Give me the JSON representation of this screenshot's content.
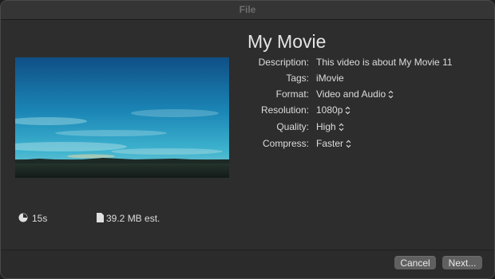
{
  "window": {
    "title": "File"
  },
  "movie": {
    "title": "My Movie"
  },
  "fields": [
    {
      "label": "Description:",
      "value": "This video is about My Movie 11",
      "stepper": false
    },
    {
      "label": "Tags:",
      "value": "iMovie",
      "stepper": false
    },
    {
      "label": "Format:",
      "value": "Video and Audio",
      "stepper": true
    },
    {
      "label": "Resolution:",
      "value": "1080p",
      "stepper": true
    },
    {
      "label": "Quality:",
      "value": "High",
      "stepper": true
    },
    {
      "label": "Compress:",
      "value": "Faster",
      "stepper": true
    }
  ],
  "stats": {
    "duration": "15s",
    "size": "39.2 MB est.",
    "duration_icon": "clock-icon",
    "size_icon": "document-icon"
  },
  "buttons": {
    "cancel": "Cancel",
    "next": "Next..."
  },
  "colors": {
    "background": "#2d2d2d",
    "text": "#dcdcdc",
    "button": "#606060"
  }
}
